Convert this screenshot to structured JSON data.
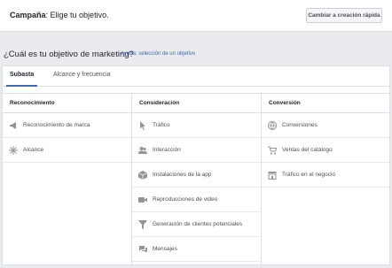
{
  "header": {
    "campaign_label": "Campaña",
    "campaign_hint": "Elige tu objetivo.",
    "quick_button": "Cambiar a creación rápida"
  },
  "objective": {
    "question": "¿Cuál es tu objetivo de marketing?",
    "help_link": "Ayuda: selección de un objetivo"
  },
  "tabs": [
    {
      "label": "Subasta",
      "active": true
    },
    {
      "label": "Alcance y frecuencia",
      "active": false
    }
  ],
  "columns": [
    {
      "title": "Reconocimiento",
      "items": [
        {
          "label": "Reconocimiento de marca",
          "icon": "megaphone-icon"
        },
        {
          "label": "Alcance",
          "icon": "sparkle-icon"
        }
      ]
    },
    {
      "title": "Consideración",
      "items": [
        {
          "label": "Tráfico",
          "icon": "cursor-icon"
        },
        {
          "label": "Interacción",
          "icon": "people-icon"
        },
        {
          "label": "Instalaciones de la app",
          "icon": "box-icon"
        },
        {
          "label": "Reproducciones de video",
          "icon": "video-icon"
        },
        {
          "label": "Generación de clientes potenciales",
          "icon": "funnel-icon"
        },
        {
          "label": "Mensajes",
          "icon": "chat-icon"
        }
      ]
    },
    {
      "title": "Conversión",
      "items": [
        {
          "label": "Conversiones",
          "icon": "globe-icon"
        },
        {
          "label": "Ventas del catálogo",
          "icon": "cart-icon"
        },
        {
          "label": "Tráfico en el negocio",
          "icon": "store-icon"
        }
      ]
    }
  ]
}
